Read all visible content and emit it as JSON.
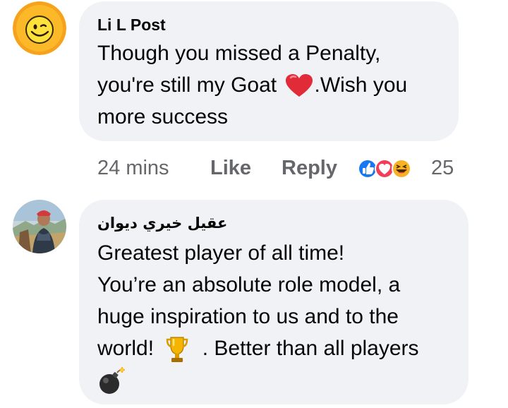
{
  "comments": [
    {
      "author": "Li L Post",
      "lines": [
        "Though you missed a Penalty,",
        "you're still my Goat",
        ".Wish you",
        "more success"
      ],
      "heart_emoji": "red-heart",
      "time": "24 mins",
      "like_label": "Like",
      "reply_label": "Reply",
      "reaction_count": "25",
      "reactions": [
        "like-reaction",
        "love-reaction",
        "haha-reaction"
      ]
    },
    {
      "author": "عقيل خيري ديوان",
      "lines": [
        "Greatest player of all time!",
        "You’re an absolute role model, a",
        "huge inspiration to us and to the",
        "world!",
        ". Better than all players"
      ],
      "emojis": [
        "trophy",
        "bomb"
      ]
    }
  ],
  "colors": {
    "bubble": "#f0f2f5",
    "meta": "#65676b",
    "like_blue": "#1877f2",
    "love_red": "#f33e58",
    "haha_yellow": "#f7b125"
  }
}
